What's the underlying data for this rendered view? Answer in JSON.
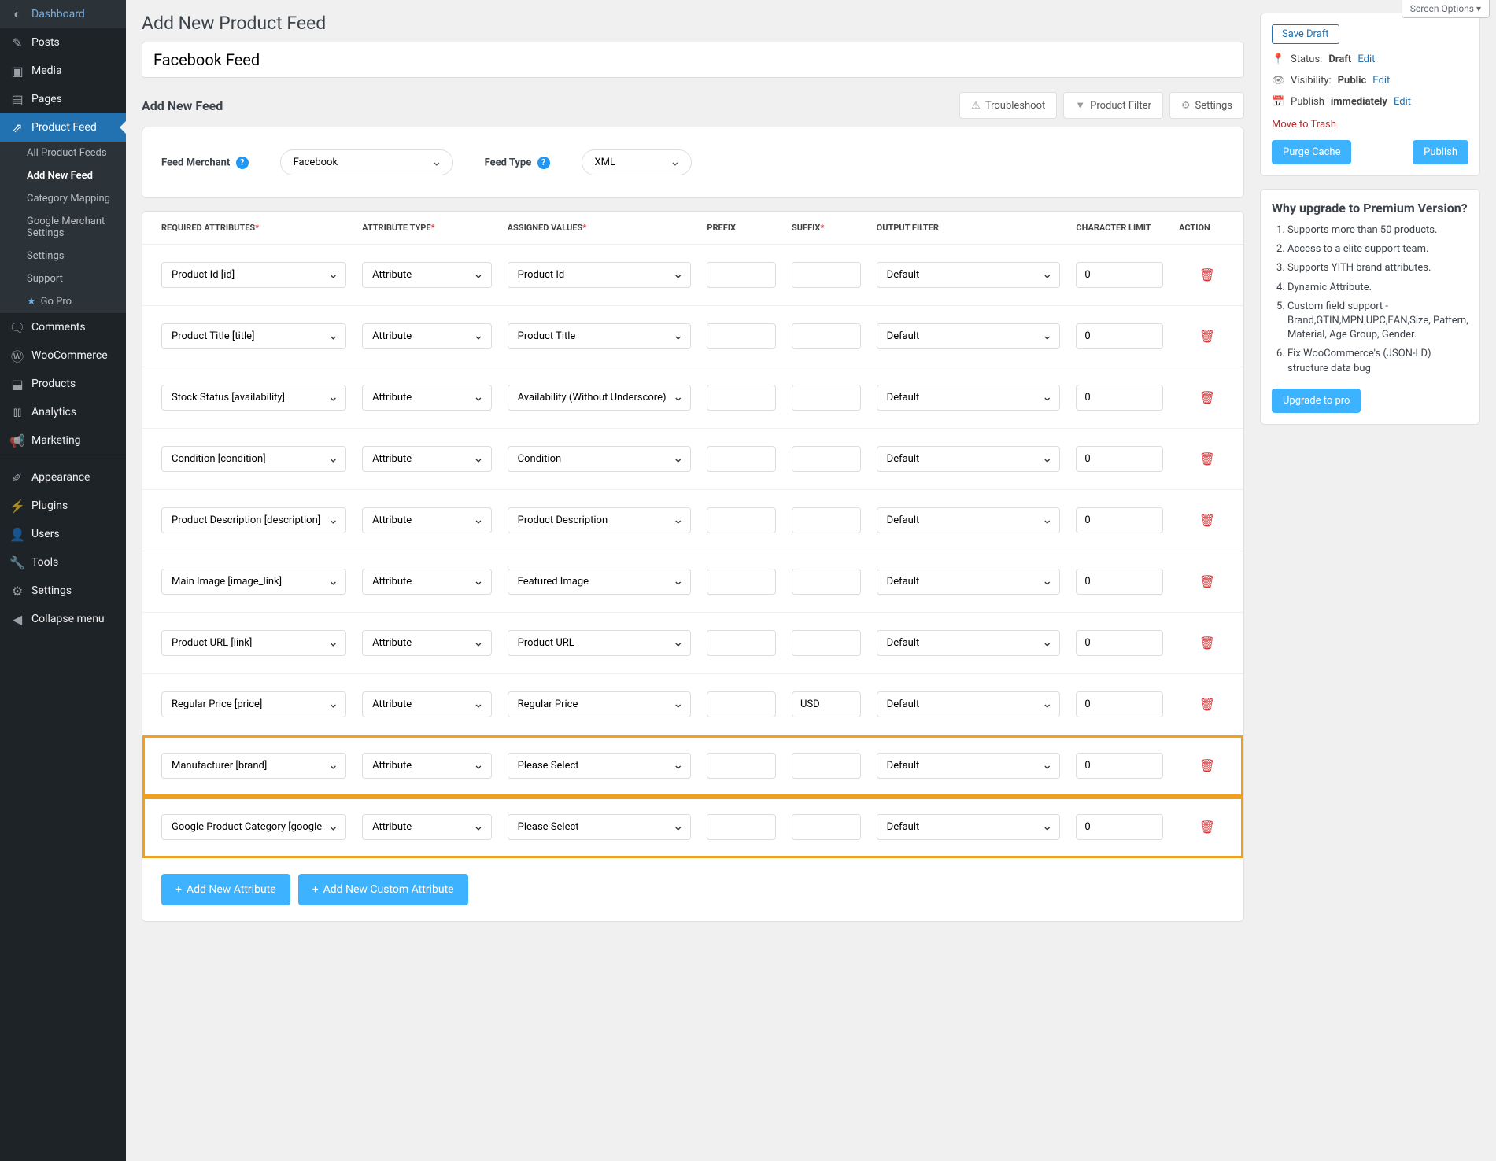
{
  "screen_options": "Screen Options ▾",
  "sidebar": [
    {
      "icon": "◐",
      "label": "Dashboard"
    },
    {
      "icon": "✎",
      "label": "Posts"
    },
    {
      "icon": "▣",
      "label": "Media"
    },
    {
      "icon": "▤",
      "label": "Pages"
    },
    {
      "icon": "⇗",
      "label": "Product Feed",
      "active": true,
      "submenu": [
        {
          "label": "All Product Feeds"
        },
        {
          "label": "Add New Feed",
          "active": true
        },
        {
          "label": "Category Mapping"
        },
        {
          "label": "Google Merchant Settings"
        },
        {
          "label": "Settings"
        },
        {
          "label": "Support"
        },
        {
          "label": "Go Pro",
          "gopro": true,
          "icon": "★"
        }
      ]
    },
    {
      "icon": "🗨",
      "label": "Comments"
    },
    {
      "icon": "Ⓦ",
      "label": "WooCommerce"
    },
    {
      "icon": "⬓",
      "label": "Products"
    },
    {
      "icon": "⫾⫾",
      "label": "Analytics"
    },
    {
      "icon": "📢",
      "label": "Marketing"
    },
    {
      "sep": true
    },
    {
      "icon": "✐",
      "label": "Appearance"
    },
    {
      "icon": "⚡",
      "label": "Plugins"
    },
    {
      "icon": "👤",
      "label": "Users"
    },
    {
      "icon": "🔧",
      "label": "Tools"
    },
    {
      "icon": "⚙",
      "label": "Settings"
    },
    {
      "icon": "◀",
      "label": "Collapse menu"
    }
  ],
  "page_title": "Add New Product Feed",
  "feed_title": "Facebook Feed",
  "subhead": "Add New Feed",
  "top_actions": {
    "troubleshoot": "Troubleshoot",
    "product_filter": "Product Filter",
    "settings": "Settings"
  },
  "merchant": {
    "label": "Feed Merchant",
    "value": "Facebook",
    "type_label": "Feed Type",
    "type_value": "XML"
  },
  "columns": {
    "required": "REQUIRED ATTRIBUTES",
    "type": "ATTRIBUTE TYPE",
    "assigned": "ASSIGNED VALUES",
    "prefix": "PREFIX",
    "suffix": "SUFFIX",
    "filter": "OUTPUT FILTER",
    "limit": "CHARACTER LIMIT",
    "action": "ACTION"
  },
  "rows": [
    {
      "req": "Product Id [id]",
      "type": "Attribute",
      "assigned": "Product Id",
      "prefix": "",
      "suffix": "",
      "filter": "Default",
      "limit": "0"
    },
    {
      "req": "Product Title [title]",
      "type": "Attribute",
      "assigned": "Product Title",
      "prefix": "",
      "suffix": "",
      "filter": "Default",
      "limit": "0"
    },
    {
      "req": "Stock Status [availability]",
      "type": "Attribute",
      "assigned": "Availability (Without Underscore)",
      "prefix": "",
      "suffix": "",
      "filter": "Default",
      "limit": "0"
    },
    {
      "req": "Condition [condition]",
      "type": "Attribute",
      "assigned": "Condition",
      "prefix": "",
      "suffix": "",
      "filter": "Default",
      "limit": "0"
    },
    {
      "req": "Product Description [description]",
      "type": "Attribute",
      "assigned": "Product Description",
      "prefix": "",
      "suffix": "",
      "filter": "Default",
      "limit": "0"
    },
    {
      "req": "Main Image [image_link]",
      "type": "Attribute",
      "assigned": "Featured Image",
      "prefix": "",
      "suffix": "",
      "filter": "Default",
      "limit": "0"
    },
    {
      "req": "Product URL [link]",
      "type": "Attribute",
      "assigned": "Product URL",
      "prefix": "",
      "suffix": "",
      "filter": "Default",
      "limit": "0"
    },
    {
      "req": "Regular Price [price]",
      "type": "Attribute",
      "assigned": "Regular Price",
      "prefix": "",
      "suffix": "USD",
      "filter": "Default",
      "limit": "0"
    },
    {
      "req": "Manufacturer [brand]",
      "type": "Attribute",
      "assigned": "Please Select",
      "prefix": "",
      "suffix": "",
      "filter": "Default",
      "limit": "0",
      "highlight": true
    },
    {
      "req": "Google Product Category [google_product_category]",
      "type": "Attribute",
      "assigned": "Please Select",
      "prefix": "",
      "suffix": "",
      "filter": "Default",
      "limit": "0",
      "highlight": true
    }
  ],
  "bottom": {
    "add_attr": "Add New Attribute",
    "add_custom": "Add New Custom Attribute"
  },
  "publish_box": {
    "save_draft": "Save Draft",
    "status_label": "Status:",
    "status_value": "Draft",
    "visibility_label": "Visibility:",
    "visibility_value": "Public",
    "publish_label": "Publish",
    "publish_value": "immediately",
    "edit": "Edit",
    "trash": "Move to Trash",
    "purge": "Purge Cache",
    "publish_btn": "Publish"
  },
  "why": {
    "title": "Why upgrade to Premium Version?",
    "items": [
      "Supports more than 50 products.",
      "Access to a elite support team.",
      "Supports YITH brand attributes.",
      "Dynamic Attribute.",
      "Custom field support - Brand,GTIN,MPN,UPC,EAN,Size, Pattern, Material, Age Group, Gender.",
      "Fix WooCommerce's (JSON-LD) structure data bug"
    ],
    "btn": "Upgrade to pro"
  }
}
